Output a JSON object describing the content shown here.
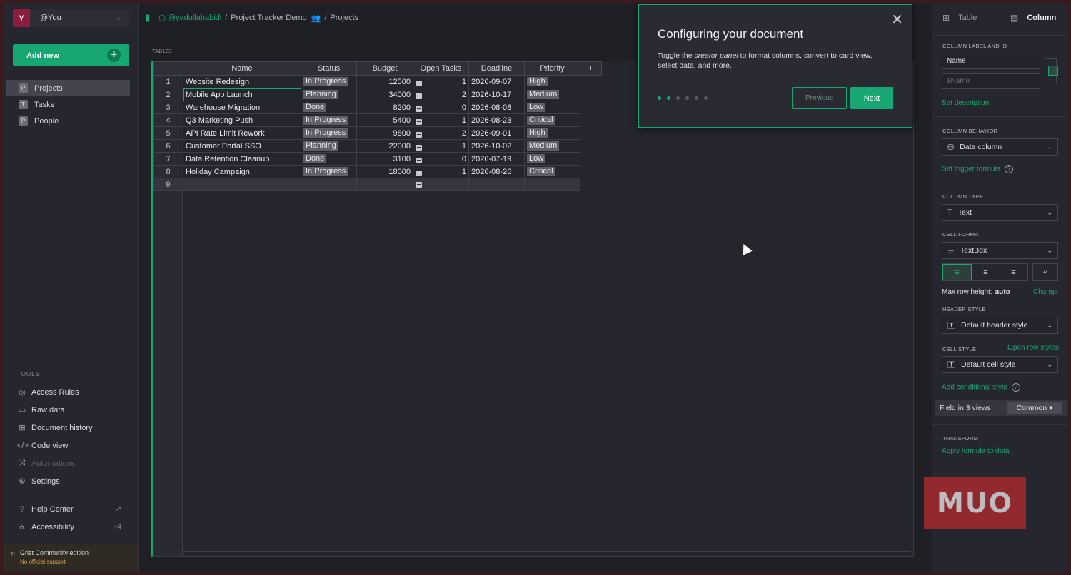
{
  "account": {
    "initial": "Y",
    "name": "@You"
  },
  "add_new": {
    "label": "Add new",
    "plus": "+"
  },
  "pages": [
    {
      "icon": "P",
      "label": "Projects",
      "active": true
    },
    {
      "icon": "T",
      "label": "Tasks"
    },
    {
      "icon": "P",
      "label": "People"
    }
  ],
  "tools": {
    "heading": "TOOLS",
    "items": [
      {
        "icon": "◎",
        "label": "Access Rules"
      },
      {
        "icon": "▭",
        "label": "Raw data"
      },
      {
        "icon": "⊞",
        "label": "Document history"
      },
      {
        "icon": "</>",
        "label": "Code view"
      },
      {
        "icon": "⤨",
        "label": "Automations"
      },
      {
        "icon": "⚙",
        "label": "Settings"
      }
    ],
    "help_center": "Help Center",
    "accessibility": "Accessibility",
    "accessibility_key": "F4"
  },
  "edition": {
    "name": "Grist Community edition",
    "support": "No official support"
  },
  "breadcrumb": {
    "workspace": "@yadullahabidi",
    "sep": "/",
    "doc": "Project Tracker Demo",
    "page": "Projects"
  },
  "table": {
    "label": "TABLE1",
    "columns": [
      "Name",
      "Status",
      "Budget",
      "Open Tasks",
      "Deadline",
      "Priority"
    ],
    "add_column": "+",
    "rows": [
      {
        "n": "1",
        "name": "Website Redesign",
        "status": "In Progress",
        "budget": "12500",
        "open": "1",
        "deadline": "2026-09-07",
        "priority": "High"
      },
      {
        "n": "2",
        "name": "Mobile App Launch",
        "status": "Planning",
        "budget": "34000",
        "open": "2",
        "deadline": "2026-10-17",
        "priority": "Medium"
      },
      {
        "n": "3",
        "name": "Warehouse Migration",
        "status": "Done",
        "budget": "8200",
        "open": "0",
        "deadline": "2026-08-08",
        "priority": "Low"
      },
      {
        "n": "4",
        "name": "Q3 Marketing Push",
        "status": "In Progress",
        "budget": "5400",
        "open": "1",
        "deadline": "2026-08-23",
        "priority": "Critical"
      },
      {
        "n": "5",
        "name": "API Rate Limit Rework",
        "status": "In Progress",
        "budget": "9800",
        "open": "2",
        "deadline": "2026-09-01",
        "priority": "High"
      },
      {
        "n": "6",
        "name": "Customer Portal SSO",
        "status": "Planning",
        "budget": "22000",
        "open": "1",
        "deadline": "2026-10-02",
        "priority": "Medium"
      },
      {
        "n": "7",
        "name": "Data Retention Cleanup",
        "status": "Done",
        "budget": "3100",
        "open": "0",
        "deadline": "2026-07-19",
        "priority": "Low"
      },
      {
        "n": "8",
        "name": "Holiday Campaign",
        "status": "In Progress",
        "budget": "18000",
        "open": "1",
        "deadline": "2026-08-26",
        "priority": "Critical"
      }
    ],
    "add_row_number": "9"
  },
  "tour": {
    "title": "Configuring your document",
    "body_before": "Toggle the ",
    "body_em": "creator panel",
    "body_after": " to format columns, convert to card view, select data, and more.",
    "prev_label": "Previous",
    "next_label": "Next",
    "step": 2,
    "total_steps": 6
  },
  "right_panel": {
    "tab_table": "Table",
    "tab_column": "Column",
    "label_heading": "COLUMN LABEL AND ID",
    "label_value": "Name",
    "id_value": "$Name",
    "set_description": "Set description",
    "behavior_heading": "COLUMN BEHAVIOR",
    "behavior_value": "Data column",
    "set_trigger": "Set trigger formula",
    "type_heading": "COLUMN TYPE",
    "type_value": "Text",
    "format_heading": "CELL FORMAT",
    "format_value": "TextBox",
    "max_row_label": "Max row height:",
    "max_row_value": "auto",
    "change": "Change",
    "header_heading": "HEADER STYLE",
    "header_value": "Default header style",
    "cell_heading": "CELL STYLE",
    "open_row_styles": "Open row styles",
    "cell_value": "Default cell style",
    "add_conditional": "Add conditional style",
    "field_in_views": "Field in 3 views",
    "common": "Common ▾",
    "transform_heading": "TRANSFORM",
    "apply_formula": "Apply formula to data"
  },
  "watermark": "MUO",
  "colors": {
    "accent": "#16a772",
    "avatar": "#8b1e3f",
    "watermark": "#b02a2f"
  }
}
